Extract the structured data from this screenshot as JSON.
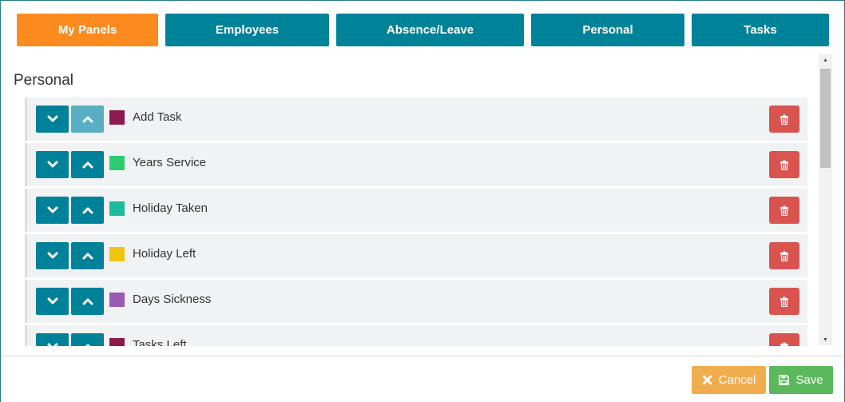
{
  "tabs": [
    {
      "label": "My Panels",
      "active": true
    },
    {
      "label": "Employees",
      "active": false
    },
    {
      "label": "Absence/Leave",
      "active": false
    },
    {
      "label": "Personal",
      "active": false
    },
    {
      "label": "Tasks",
      "active": false
    }
  ],
  "section": {
    "title": "Personal"
  },
  "panels": [
    {
      "label": "Add Task",
      "color": "#8b1a4e",
      "up_disabled": true
    },
    {
      "label": "Years Service",
      "color": "#2ecc71",
      "up_disabled": false
    },
    {
      "label": "Holiday Taken",
      "color": "#1abc9c",
      "up_disabled": false
    },
    {
      "label": "Holiday Left",
      "color": "#f1c40f",
      "up_disabled": false
    },
    {
      "label": "Days Sickness",
      "color": "#9b59b6",
      "up_disabled": false
    },
    {
      "label": "Tasks Left",
      "color": "#8b1a4e",
      "up_disabled": false
    }
  ],
  "icons": {
    "move_down": "chevron-down-icon",
    "move_up": "chevron-up-icon",
    "delete": "trash-icon",
    "cancel": "close-icon",
    "save": "floppy-disk-icon"
  },
  "footer": {
    "cancel_label": "Cancel",
    "save_label": "Save"
  },
  "colors": {
    "tab": "#008299",
    "tab_active": "#fb8b1e",
    "delete": "#d9534f",
    "cancel": "#f0ad4e",
    "save": "#5cb85c"
  }
}
